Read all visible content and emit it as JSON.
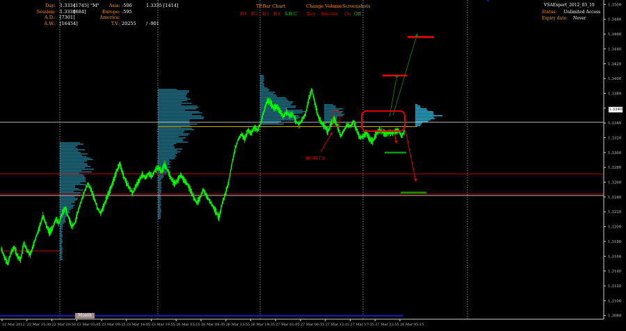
{
  "colors": {
    "background": "#000000",
    "price": "#00ff00",
    "profile": "#1e6a80",
    "profile_bright": "#2aa6c8",
    "highlight": "#e00000",
    "label_orange": "#ff9a00",
    "label_white": "#ffffff",
    "axis_text": "#c8c8c8",
    "grid": "#b4b4b4",
    "hline_red": "#c80000",
    "hline_white": "#b4b4b4",
    "hline_yellow": "#c8b000",
    "target_red": "#ff0000",
    "target_green": "#00a000",
    "sbc_green": "#00d000",
    "navy": "#1a1aa0"
  },
  "stats": {
    "rows": [
      {
        "label": "Day:",
        "value": "1.3334",
        "extra": "[1745]",
        "tag": "\"M\""
      },
      {
        "label": "Session:",
        "value": "1.3330",
        "extra": "[684]",
        "tag": ""
      },
      {
        "label": "A.D.:",
        "value": "[7301]",
        "extra": "",
        "tag": ""
      },
      {
        "label": "A.W.:",
        "value": "[16454]",
        "extra": "",
        "tag": ""
      }
    ],
    "sessions": [
      {
        "label": "Asia:",
        "value": "-506",
        "extra": "1.3335 [1414]"
      },
      {
        "label": "Europe:",
        "value": "-595",
        "extra": ""
      },
      {
        "label": "America:",
        "value": "",
        "extra": ""
      },
      {
        "label": "T.V.:",
        "value": "20255",
        "extra": "/ -901"
      }
    ]
  },
  "toolbar": {
    "tp_title": "TP.Bar Chart",
    "tp_items": [
      "H1",
      "H2",
      "H3",
      "H4"
    ],
    "sbc": "S.B.C",
    "cv_title": "Change Volume",
    "cv_items": [
      "Day",
      "Session"
    ],
    "ss_title": "Screenshots",
    "ss_on": "On",
    "ss_off": "Off"
  },
  "info": {
    "expert_name": "VSAExpert_2012_03_19",
    "status_label": "Status:",
    "status_value": "Unlimited Access",
    "expiry_label": "Expiry date:",
    "expiry_value": "Never"
  },
  "annotation": "деньга",
  "bottom_label": "Month",
  "price_tag": "1.3340",
  "chart_data": {
    "type": "line",
    "title": "",
    "ylim": [
      1.3075,
      1.3506
    ],
    "y_ticks": [
      "1.3500",
      "1.3480",
      "1.3460",
      "1.3440",
      "1.3420",
      "1.3400",
      "1.3380",
      "1.3360",
      "1.3340",
      "1.3320",
      "1.3300",
      "1.3280",
      "1.3260",
      "1.3240",
      "1.3220",
      "1.3200",
      "1.3180",
      "1.3160",
      "1.3140",
      "1.3120",
      "1.3100",
      "1.3080"
    ],
    "x_ticks": [
      "22 Mar 2012",
      "22 Mar 15:30",
      "22 Mar 20:50",
      "23 Mar 03:05",
      "23 Mar 09:25",
      "23 Mar 14:05",
      "23 Mar 19:55",
      "26 Mar 03:15",
      "26 Mar 08:35",
      "26 Mar 13:55",
      "26 Mar 19:35",
      "27 Mar 01:05",
      "27 Mar 06:55",
      "27 Mar 12:15",
      "27 Mar 17:35",
      "27 Mar 22:55",
      "28 Mar 05:15"
    ],
    "h_lines": [
      {
        "y": 1.3341,
        "color": "white"
      },
      {
        "y": 1.3335,
        "color": "yellow"
      },
      {
        "y": 1.3244,
        "color": "red"
      },
      {
        "y": 1.3242,
        "color": "white"
      },
      {
        "y": 1.3271,
        "color": "red"
      }
    ],
    "targets": [
      {
        "y": 1.3456,
        "color": "red"
      },
      {
        "y": 1.3404,
        "color": "red"
      },
      {
        "y": 1.33,
        "color": "green"
      },
      {
        "y": 1.3246,
        "color": "green"
      }
    ],
    "series": [
      {
        "values": [
          1.317,
          1.3158,
          1.315,
          1.3165,
          1.3172,
          1.316,
          1.3155,
          1.3178,
          1.3168,
          1.3162,
          1.3175,
          1.3188,
          1.32,
          1.3215,
          1.3202,
          1.3192,
          1.3198,
          1.321,
          1.3205,
          1.3218,
          1.3225,
          1.3212,
          1.32,
          1.3205,
          1.3222,
          1.3235,
          1.3248,
          1.3258,
          1.325,
          1.3238,
          1.3225,
          1.3218,
          1.3228,
          1.324,
          1.325,
          1.3262,
          1.3275,
          1.3285,
          1.327,
          1.326,
          1.3252,
          1.3245,
          1.3255,
          1.3262,
          1.327,
          1.3266,
          1.3272,
          1.3268,
          1.3276,
          1.328,
          1.3274,
          1.3284,
          1.3275,
          1.3265,
          1.3258,
          1.3262,
          1.327,
          1.3263,
          1.3258,
          1.325,
          1.324,
          1.3232,
          1.3238,
          1.325,
          1.3242,
          1.3235,
          1.3228,
          1.322,
          1.3212,
          1.3232,
          1.3245,
          1.326,
          1.3285,
          1.3305,
          1.3318,
          1.3325,
          1.3318,
          1.333,
          1.3326,
          1.3334,
          1.333,
          1.334,
          1.3356,
          1.337,
          1.3368,
          1.336,
          1.3362,
          1.3356,
          1.3348,
          1.3355,
          1.335,
          1.3352,
          1.3342,
          1.3338,
          1.3345,
          1.3352,
          1.3372,
          1.3385,
          1.3365,
          1.3348,
          1.334,
          1.3335,
          1.3328,
          1.334,
          1.3345,
          1.3335,
          1.3322,
          1.333,
          1.3338,
          1.3335,
          1.3342,
          1.333,
          1.332,
          1.3322,
          1.3327,
          1.3318,
          1.3315,
          1.3325,
          1.333,
          1.3328,
          1.3325,
          1.3327,
          1.3326,
          1.3328,
          1.333,
          1.3322,
          1.333
        ]
      }
    ]
  }
}
